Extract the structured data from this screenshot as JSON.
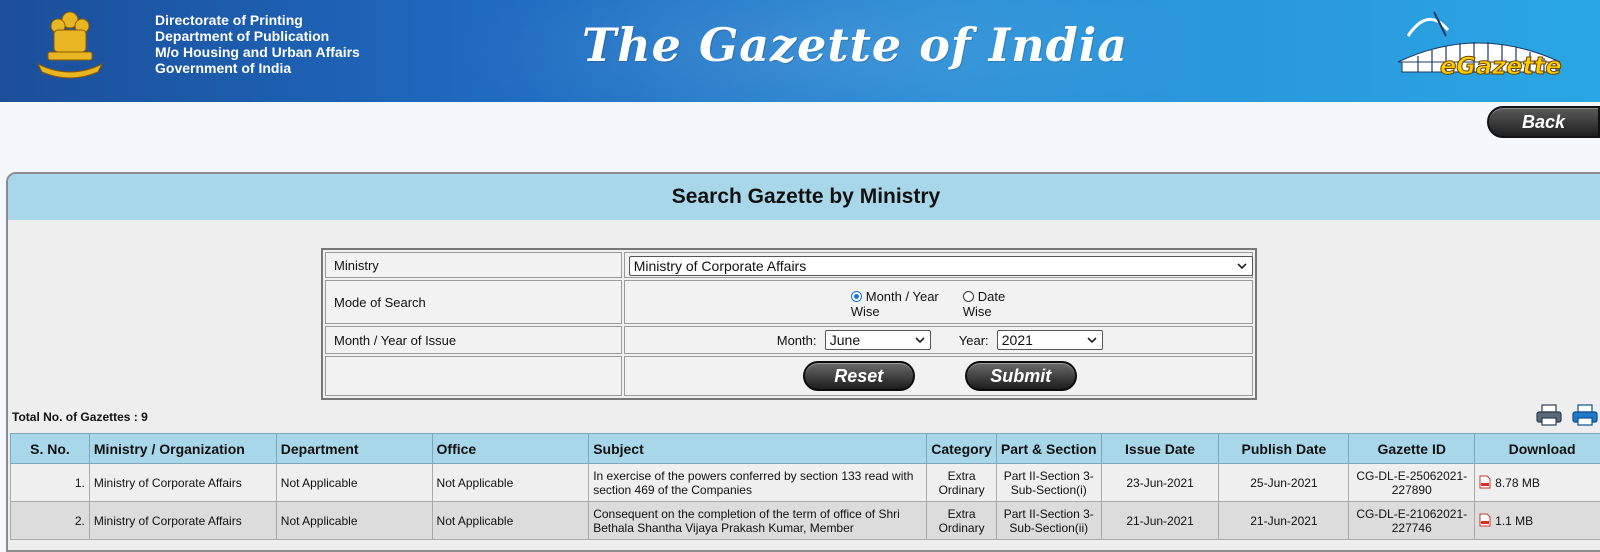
{
  "header": {
    "dept_lines": [
      "Directorate of Printing",
      "Department of Publication",
      "M/o Housing and Urban Affairs",
      "Government of India"
    ],
    "title": "The Gazette of India",
    "logo_text": "eGazette",
    "emblem_icon": "national-emblem-icon"
  },
  "nav": {
    "back_label": "Back"
  },
  "panel": {
    "title": "Search Gazette by Ministry"
  },
  "form": {
    "ministry_label": "Ministry",
    "ministry_value": "Ministry of Corporate Affairs",
    "mode_label": "Mode of Search",
    "mode_options": [
      {
        "line1": "Month / Year",
        "line2": "Wise",
        "selected": true
      },
      {
        "line1": "Date",
        "line2": "Wise",
        "selected": false
      }
    ],
    "issue_label": "Month / Year of Issue",
    "month_label": "Month:",
    "month_value": "June",
    "year_label": "Year:",
    "year_value": "2021",
    "reset_label": "Reset",
    "submit_label": "Submit"
  },
  "results": {
    "total_text": "Total No. of Gazettes : 9",
    "columns": [
      "S. No.",
      "Ministry / Organization",
      "Department",
      "Office",
      "Subject",
      "Category",
      "Part & Section",
      "Issue Date",
      "Publish Date",
      "Gazette ID",
      "Download"
    ],
    "rows": [
      {
        "sno": "1.",
        "ministry": "Ministry of Corporate Affairs",
        "department": "Not Applicable",
        "office": "Not Applicable",
        "subject": "In exercise of the powers conferred by section 133 read with section 469 of the Companies",
        "category": "Extra Ordinary",
        "part_section": "Part II-Section 3-Sub-Section(i)",
        "issue_date": "23-Jun-2021",
        "publish_date": "25-Jun-2021",
        "gazette_id": "CG-DL-E-25062021-227890",
        "download": "8.78 MB"
      },
      {
        "sno": "2.",
        "ministry": "Ministry of Corporate Affairs",
        "department": "Not Applicable",
        "office": "Not Applicable",
        "subject": "Consequent on the completion of the term of office of Shri Bethala Shantha Vijaya Prakash Kumar, Member",
        "category": "Extra Ordinary",
        "part_section": "Part II-Section 3-Sub-Section(ii)",
        "issue_date": "21-Jun-2021",
        "publish_date": "21-Jun-2021",
        "gazette_id": "CG-DL-E-21062021-227746",
        "download": "1.1 MB"
      }
    ]
  },
  "colors": {
    "header_blue": "#1f69bf",
    "panel_header": "#a9d7ea",
    "button_dark": "#1d1d1d"
  }
}
